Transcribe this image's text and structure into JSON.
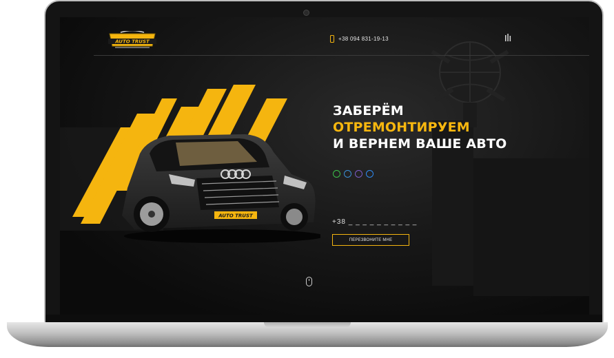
{
  "brand": {
    "logo_text": "AUTO TRUST",
    "logo_plate_text": "AUTO TRUST"
  },
  "header": {
    "phone": "+38 094 831-19-13"
  },
  "hero": {
    "line1": "ЗАБЕРЁМ",
    "line2": "ОТРЕМОНТИРУЕМ",
    "line3": "И ВЕРНЕМ ВАШЕ АВТО"
  },
  "messengers": [
    {
      "name": "whatsapp-icon",
      "color": "#3cc24a"
    },
    {
      "name": "telegram-icon",
      "color": "#3a8fd8"
    },
    {
      "name": "viber-icon",
      "color": "#7d5cc9"
    },
    {
      "name": "messenger-icon",
      "color": "#2f8cf5"
    }
  ],
  "form": {
    "phone_placeholder": "+38 _ _ _  _ _  _ _  _ _ _",
    "button_label": "ПЕРЕЗВОНИТЕ МНЕ"
  },
  "colors": {
    "accent": "#f7b70f",
    "background": "#0b0b0b"
  }
}
